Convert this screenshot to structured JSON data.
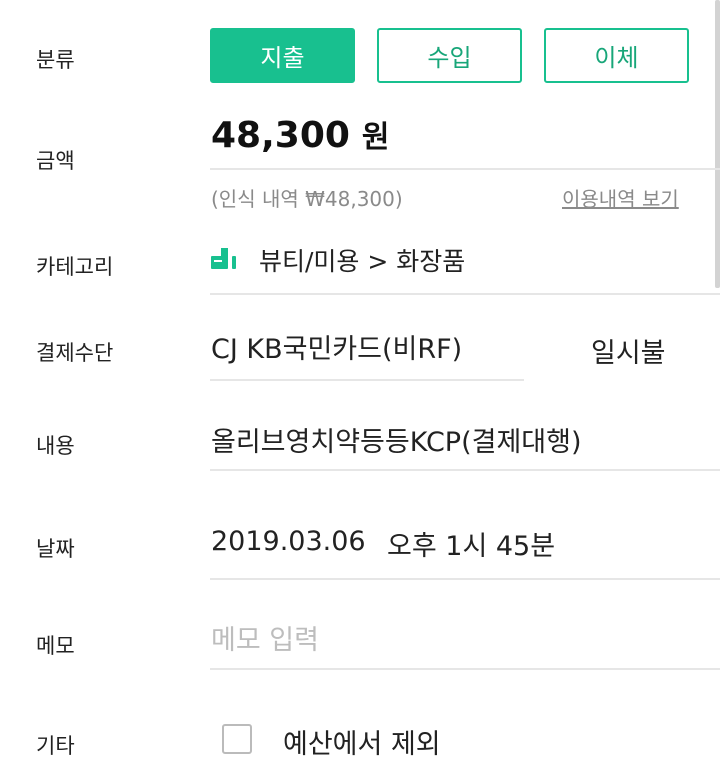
{
  "labels": {
    "type": "분류",
    "amount": "금액",
    "category": "카테고리",
    "payment": "결제수단",
    "content": "내용",
    "date": "날짜",
    "memo": "메모",
    "other": "기타"
  },
  "type_tabs": [
    "지출",
    "수입",
    "이체"
  ],
  "amount": {
    "value": "48,300",
    "unit": "원",
    "recognized": "(인식 내역 ₩48,300)",
    "history_link": "이용내역 보기"
  },
  "category": {
    "value": "뷰티/미용  >  화장품",
    "icon": "beauty-category-icon"
  },
  "payment": {
    "card": "CJ KB국민카드(비RF)",
    "installment": "일시불"
  },
  "content": "올리브영치약등등KCP(결제대행)",
  "date": {
    "date": "2019.03.06",
    "time": "오후 1시 45분"
  },
  "memo": {
    "placeholder": "메모 입력"
  },
  "other": {
    "exclude_budget": "예산에서 제외",
    "checked": false
  },
  "colors": {
    "accent": "#18c08f",
    "text": "#222222",
    "muted": "#8a8a8a"
  }
}
